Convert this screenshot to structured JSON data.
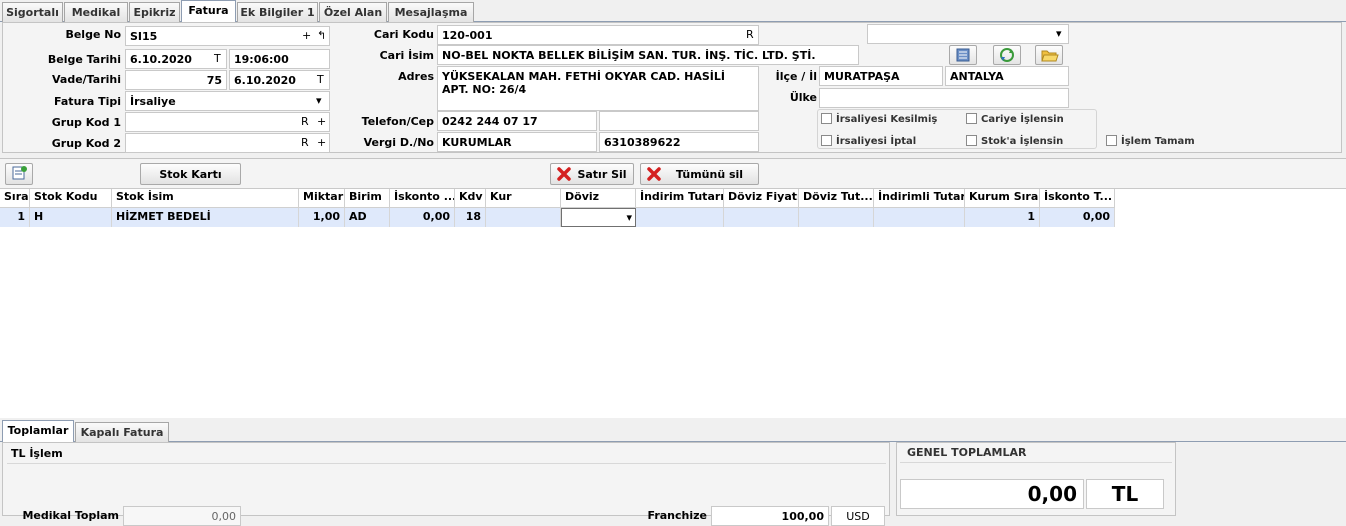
{
  "tabs": [
    "Sigortalı",
    "Medikal",
    "Epikriz",
    "Fatura",
    "Ek Bilgiler 1",
    "Özel Alan",
    "Mesajlaşma"
  ],
  "form": {
    "belge_no_label": "Belge No",
    "belge_no": "SI15",
    "belge_tarihi_label": "Belge Tarihi",
    "belge_tarihi": "6.10.2020",
    "belge_saat": "19:06:00",
    "vade_label": "Vade/Tarihi",
    "vade_gun": "75",
    "vade_tarih": "6.10.2020",
    "fatura_tipi_label": "Fatura Tipi",
    "fatura_tipi": "İrsaliye",
    "grup_kod1_label": "Grup Kod 1",
    "grup_kod2_label": "Grup Kod 2",
    "cari_kodu_label": "Cari Kodu",
    "cari_kodu": "120-001",
    "cari_isim_label": "Cari İsim",
    "cari_isim": "NO-BEL NOKTA BELLEK BİLİŞİM SAN. TUR. İNŞ. TİC. LTD. ŞTİ.",
    "adres_label": "Adres",
    "adres": "YÜKSEKALAN MAH. FETHİ OKYAR CAD. HASİLİ APT. NO: 26/4",
    "telefon_label": "Telefon/Cep",
    "telefon": "0242 244 07 17",
    "vergi_label": "Vergi D./No",
    "vergi_daire": "KURUMLAR",
    "vergi_no": "6310389622",
    "ilce_label": "İlçe / İl",
    "ilce": "MURATPAŞA",
    "il": "ANTALYA",
    "ulke_label": "Ülke",
    "btn_r": "R",
    "btn_t": "T",
    "btn_plus": "+",
    "btn_undo": "↰",
    "btn_drop": "▾"
  },
  "checks": {
    "irsaliyesi_kesilmis": "İrsaliyesi Kesilmiş",
    "cariye_islensin": "Cariye İşlensin",
    "irsaliyesi_iptal": "İrsaliyesi İptal",
    "stoka_islensin": "Stok'a İşlensin",
    "islem_tamam": "İşlem Tamam"
  },
  "toolbar": {
    "stok_karti": "Stok Kartı",
    "satir_sil": "Satır Sil",
    "tumunu_sil": "Tümünü sil"
  },
  "grid": {
    "headers": [
      "Sıra",
      "Stok Kodu",
      "Stok İsim",
      "Miktar",
      "Birim",
      "İskonto ...",
      "Kdv",
      "Kur",
      "Döviz",
      "İndirim Tutarı",
      "Döviz Fiyatı",
      "Döviz Tut...",
      "İndirimli Tutar",
      "Kurum Sıra",
      "İskonto T..."
    ],
    "row": {
      "sira": "1",
      "stok_kodu": "H",
      "stok_isim": "HİZMET BEDELİ",
      "miktar": "1,00",
      "birim": "AD",
      "iskonto": "0,00",
      "kdv": "18",
      "kurum_sira": "1",
      "iskonto_t": "0,00"
    }
  },
  "bottom": {
    "tabs": [
      "Toplamlar",
      "Kapalı Fatura"
    ],
    "tl_islem": "TL İşlem",
    "medikal_toplam_label": "Medikal Toplam",
    "medikal_toplam": "0,00",
    "franchize_label": "Franchize",
    "franchize": "100,00",
    "franchize_currency": "USD",
    "genel_toplamlar": "GENEL TOPLAMLAR",
    "genel_toplam": "0,00",
    "genel_currency": "TL"
  }
}
